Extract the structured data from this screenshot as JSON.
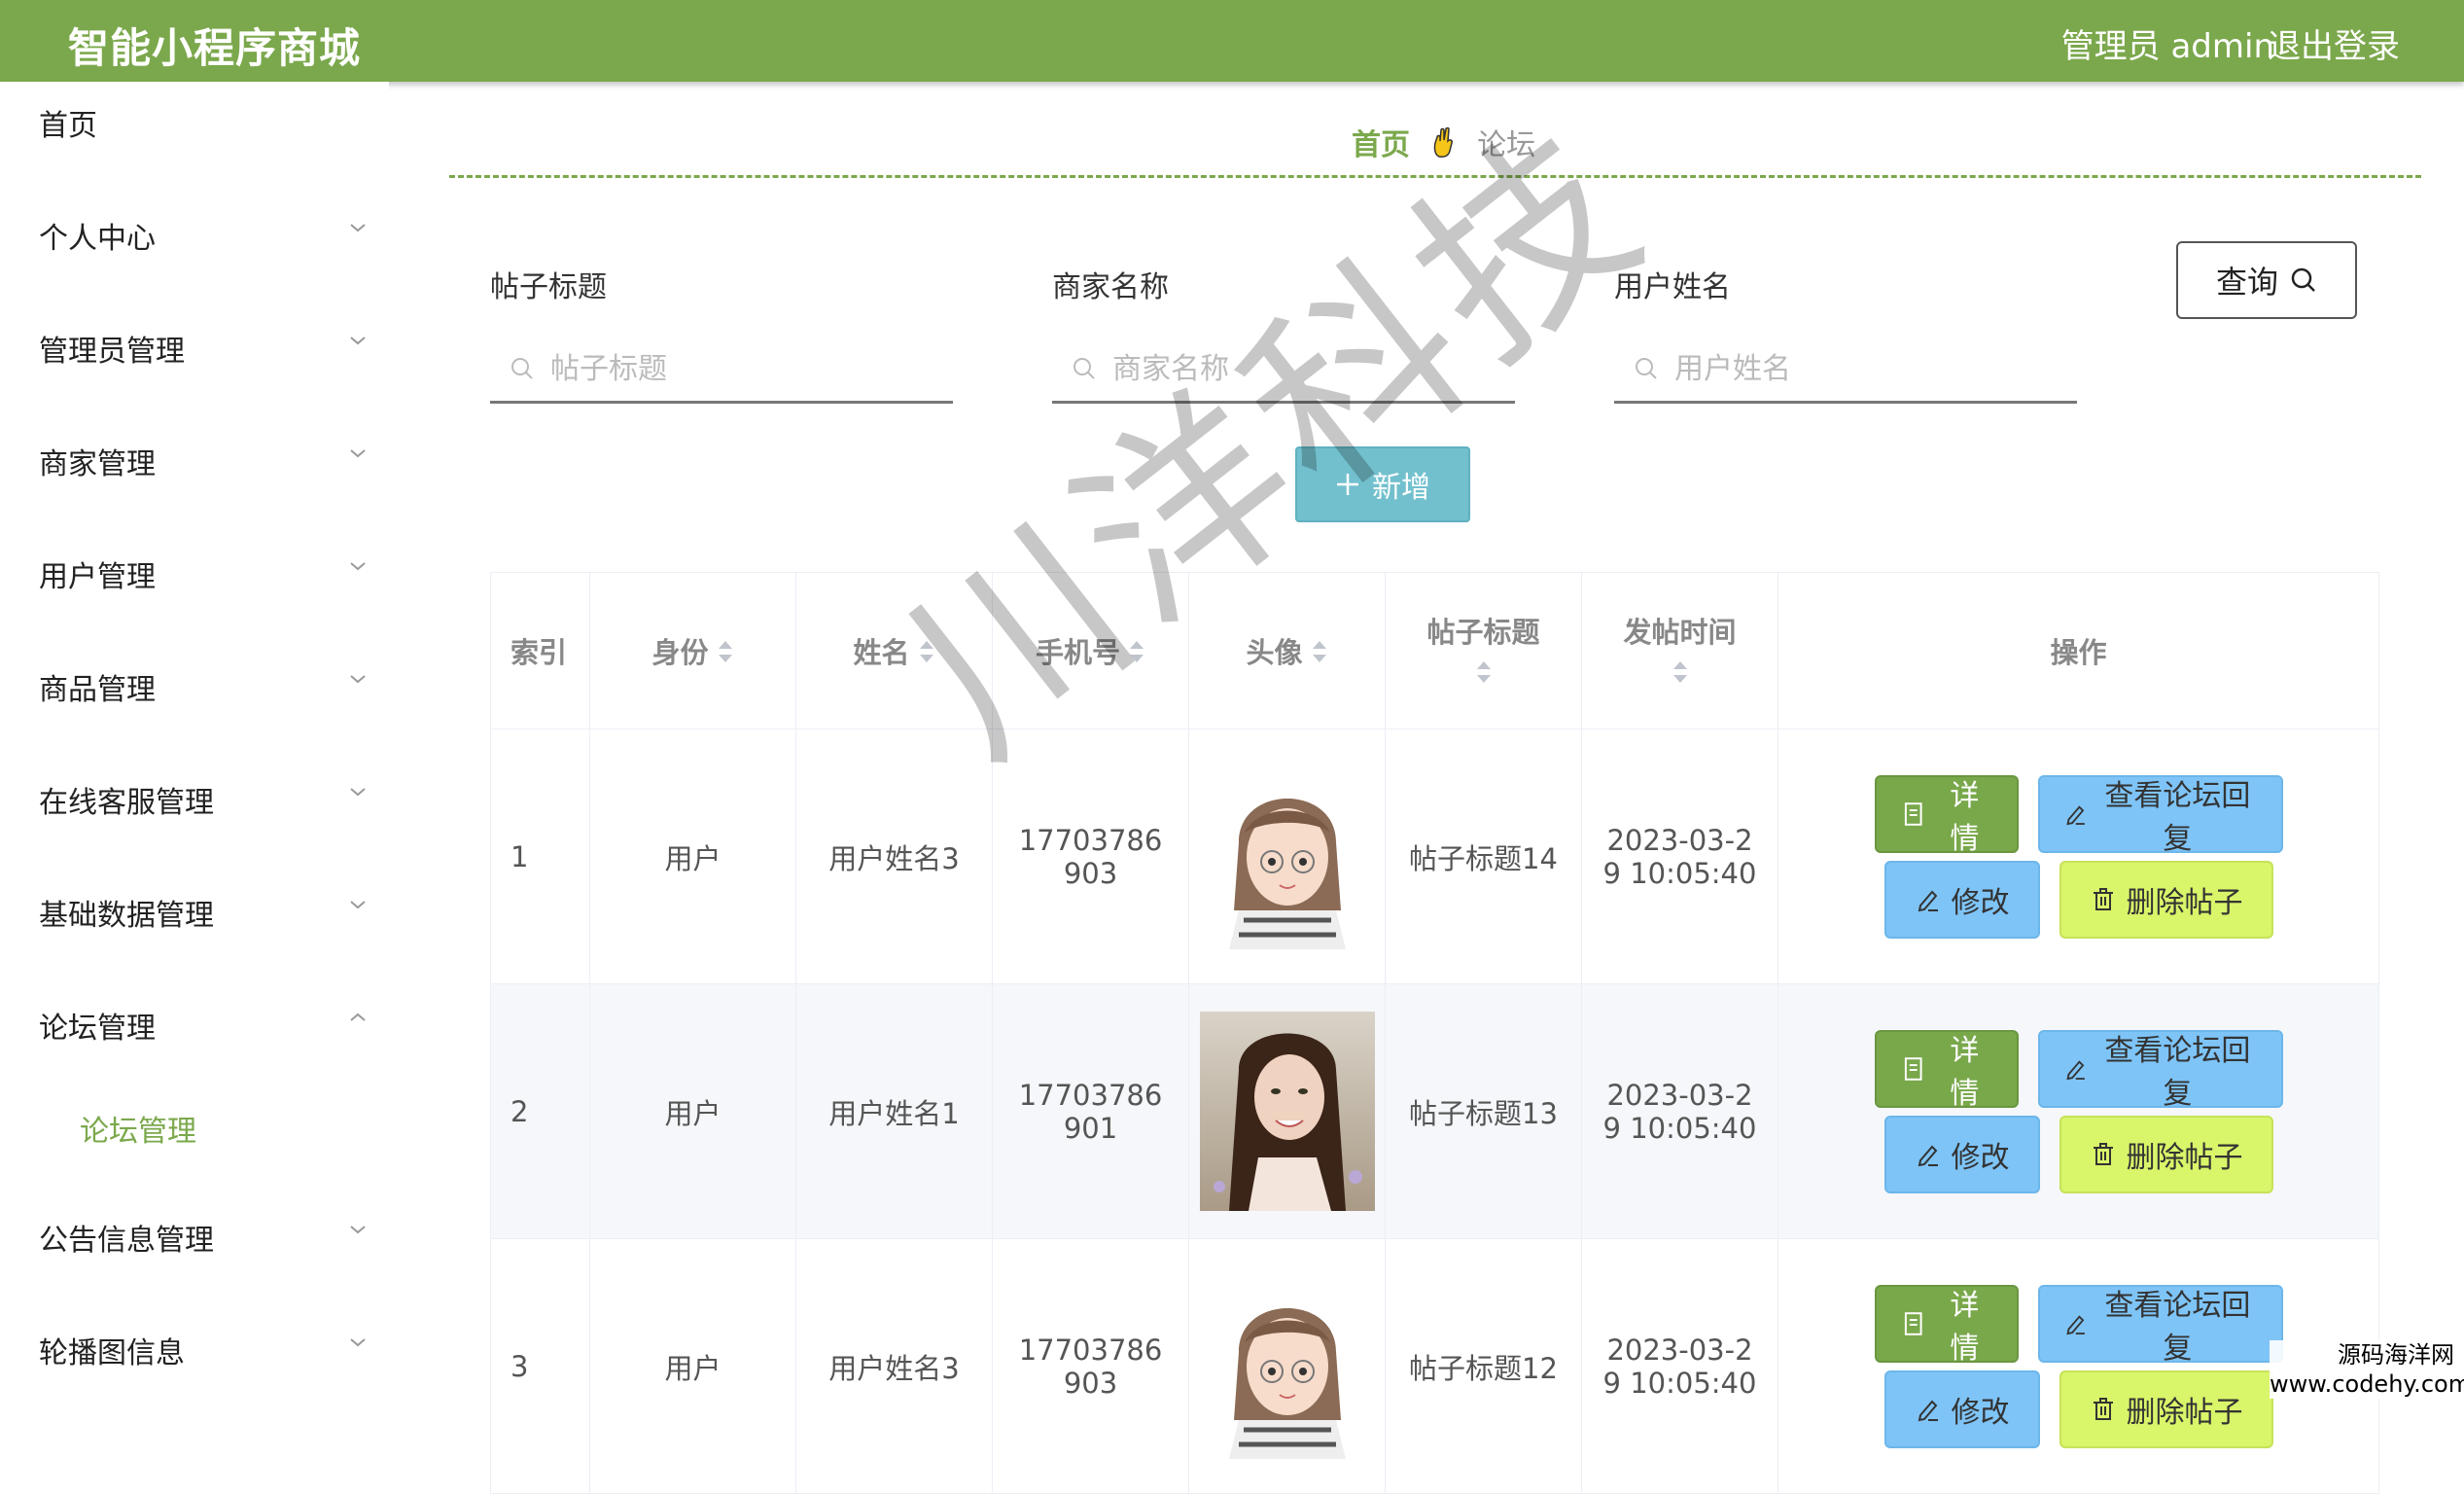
{
  "header": {
    "brand": "智能小程序商城",
    "admin": "管理员 admin",
    "logout": "退出登录"
  },
  "sidebar": {
    "items": [
      {
        "label": "首页",
        "chevron": "none"
      },
      {
        "label": "个人中心",
        "chevron": "down"
      },
      {
        "label": "管理员管理",
        "chevron": "down"
      },
      {
        "label": "商家管理",
        "chevron": "down"
      },
      {
        "label": "用户管理",
        "chevron": "down"
      },
      {
        "label": "商品管理",
        "chevron": "down"
      },
      {
        "label": "在线客服管理",
        "chevron": "down"
      },
      {
        "label": "基础数据管理",
        "chevron": "down"
      },
      {
        "label": "论坛管理",
        "chevron": "up"
      },
      {
        "label": "公告信息管理",
        "chevron": "down"
      },
      {
        "label": "轮播图信息",
        "chevron": "down"
      }
    ],
    "submenu": {
      "label": "论坛管理"
    }
  },
  "breadcrumb": {
    "home": "首页",
    "separator_icon": "hand-icon",
    "current": "论坛"
  },
  "search": {
    "fields": [
      {
        "label": "帖子标题",
        "placeholder": "帖子标题"
      },
      {
        "label": "商家名称",
        "placeholder": "商家名称"
      },
      {
        "label": "用户姓名",
        "placeholder": "用户姓名"
      }
    ],
    "query_label": "查询"
  },
  "toolbar": {
    "add_label": "新增"
  },
  "table": {
    "headers": [
      "索引",
      "身份",
      "姓名",
      "手机号",
      "头像",
      "帖子标题",
      "发帖时间",
      "操作"
    ],
    "rows": [
      {
        "index": "1",
        "identity": "用户",
        "name": "用户姓名3",
        "phone": "17703786903",
        "avatar": "cartoon",
        "title": "帖子标题14",
        "time": "2023-03-29 10:05:40"
      },
      {
        "index": "2",
        "identity": "用户",
        "name": "用户姓名1",
        "phone": "17703786901",
        "avatar": "photo",
        "title": "帖子标题13",
        "time": "2023-03-29 10:05:40"
      },
      {
        "index": "3",
        "identity": "用户",
        "name": "用户姓名3",
        "phone": "17703786903",
        "avatar": "cartoon",
        "title": "帖子标题12",
        "time": "2023-03-29 10:05:40"
      }
    ],
    "actions": {
      "detail": "详情",
      "reply": "查看论坛回复",
      "edit": "修改",
      "delete": "删除帖子"
    }
  },
  "watermark": "川洋科技",
  "corner_mark": {
    "line1": "源码海洋网",
    "line2": "www.codehy.com"
  },
  "colors": {
    "primary": "#7ba84c",
    "info": "#72c0ce",
    "light_blue": "#7ec4f7",
    "lime": "#d9f56a"
  }
}
